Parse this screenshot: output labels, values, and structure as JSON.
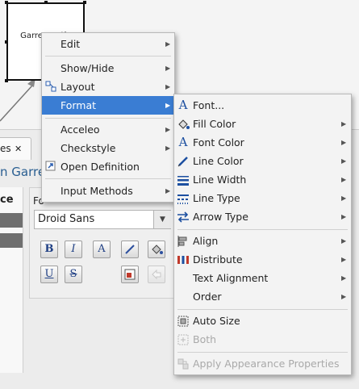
{
  "canvas": {
    "node_label": "Garret Wolfe"
  },
  "properties_view": {
    "tab_label": "es",
    "tab_close": "✕",
    "title": "n Garret",
    "left_column_header": "ce",
    "font_section_label": "Fo",
    "font_combo_value": "Droid Sans",
    "font_combo_arrow": "▼",
    "buttons": {
      "bold": "B",
      "italic": "I",
      "font": "A",
      "underline": "U",
      "strike": "S"
    }
  },
  "context_menu": {
    "items": [
      {
        "label": "Edit",
        "mnemonic": "E",
        "submenu": true
      },
      {
        "label": "Show/Hide",
        "submenu": true
      },
      {
        "label": "Layout",
        "submenu": true,
        "icon": "layout-icon"
      },
      {
        "label": "Format",
        "mnemonic": "F",
        "submenu": true,
        "selected": true
      },
      {
        "label": "Acceleo",
        "submenu": true
      },
      {
        "label": "Checkstyle",
        "submenu": true
      },
      {
        "label": "Open Definition",
        "submenu": false,
        "icon": "open-definition-icon"
      },
      {
        "label": "Input Methods",
        "submenu": true
      }
    ],
    "arrow": "▶"
  },
  "format_menu": {
    "items": [
      {
        "label": "Font...",
        "icon": "font-icon",
        "submenu": false
      },
      {
        "label": "Fill Color",
        "icon": "fill-color-icon",
        "submenu": true
      },
      {
        "label": "Font Color",
        "icon": "font-color-icon",
        "submenu": true
      },
      {
        "label": "Line Color",
        "icon": "line-color-icon",
        "submenu": true
      },
      {
        "label": "Line Width",
        "icon": "line-width-icon",
        "submenu": true
      },
      {
        "label": "Line Type",
        "icon": "line-type-icon",
        "submenu": true
      },
      {
        "label": "Arrow Type",
        "icon": "arrow-type-icon",
        "submenu": true
      },
      {
        "label": "Align",
        "icon": "align-icon",
        "submenu": true
      },
      {
        "label": "Distribute",
        "icon": "distribute-icon",
        "submenu": true
      },
      {
        "label": "Text Alignment",
        "submenu": true
      },
      {
        "label": "Order",
        "submenu": true
      },
      {
        "label": "Auto Size",
        "icon": "auto-size-icon",
        "submenu": false
      },
      {
        "label": "Both",
        "icon": "both-icon",
        "submenu": false,
        "disabled": true
      },
      {
        "label": "Apply Appearance Properties",
        "icon": "apply-appearance-icon",
        "submenu": false,
        "disabled": true
      }
    ],
    "arrow": "▶"
  },
  "colors": {
    "selection": "#3a7dd3",
    "accent_text": "#295e91",
    "disabled_text": "#a9a9a9"
  }
}
